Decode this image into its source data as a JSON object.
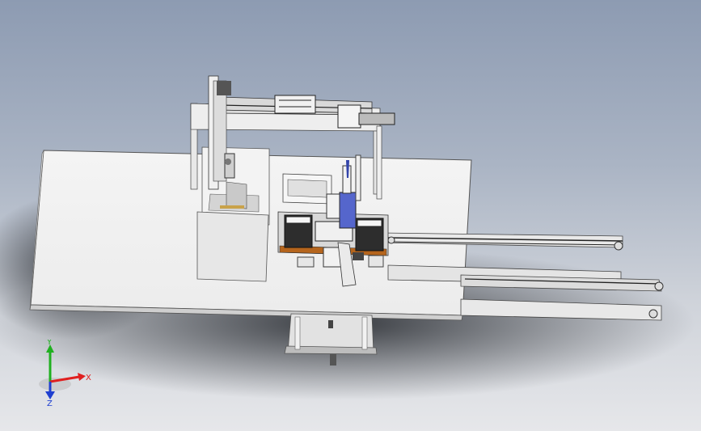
{
  "viewport": {
    "background_top": "#8d9bb2",
    "background_bottom": "#e6e7ea"
  },
  "triad": {
    "x_label": "X",
    "y_label": "Y",
    "z_label": "Z",
    "x_color": "#e02020",
    "y_color": "#20b020",
    "z_color": "#2040d0"
  }
}
